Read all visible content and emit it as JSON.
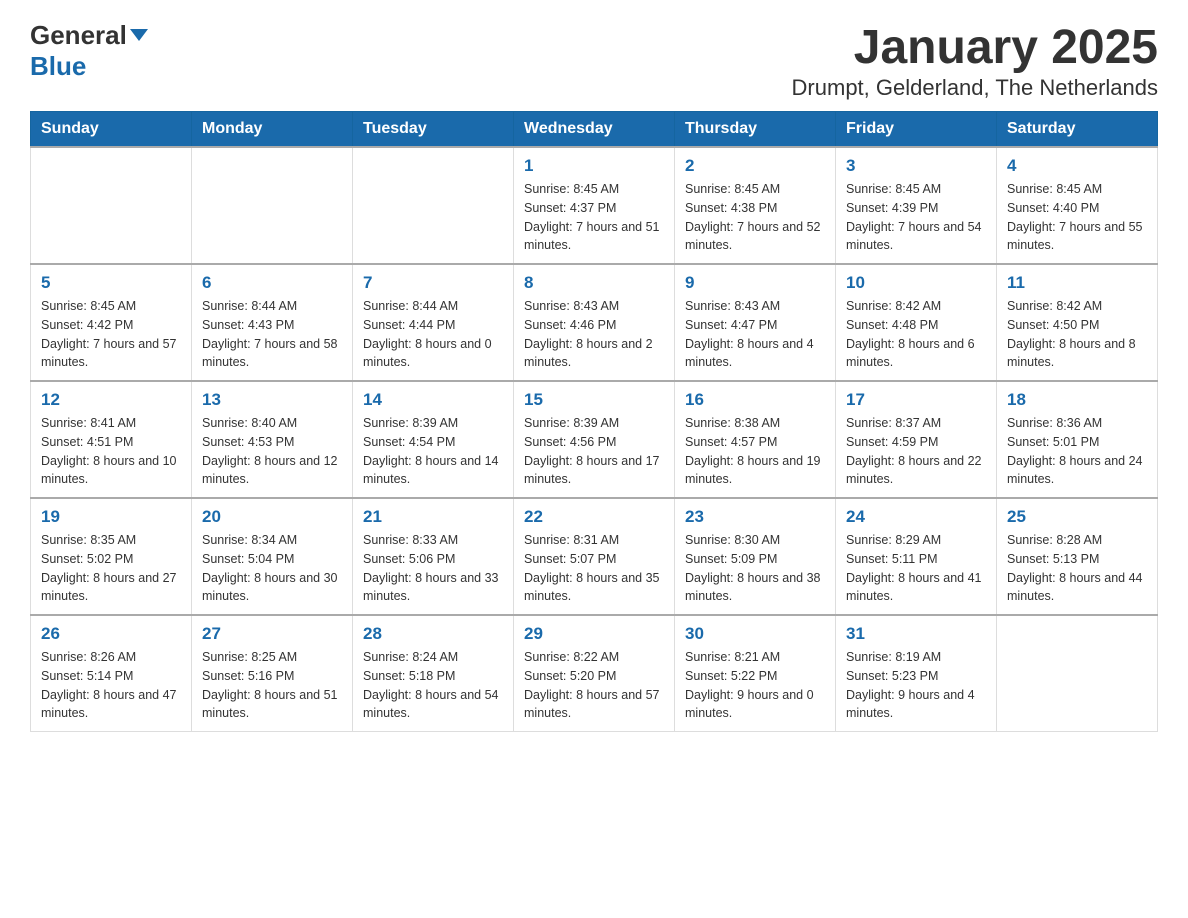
{
  "header": {
    "logo_text_general": "General",
    "logo_text_blue": "Blue",
    "title": "January 2025",
    "subtitle": "Drumpt, Gelderland, The Netherlands"
  },
  "weekdays": [
    "Sunday",
    "Monday",
    "Tuesday",
    "Wednesday",
    "Thursday",
    "Friday",
    "Saturday"
  ],
  "weeks": [
    [
      {
        "day": "",
        "info": ""
      },
      {
        "day": "",
        "info": ""
      },
      {
        "day": "",
        "info": ""
      },
      {
        "day": "1",
        "info": "Sunrise: 8:45 AM\nSunset: 4:37 PM\nDaylight: 7 hours\nand 51 minutes."
      },
      {
        "day": "2",
        "info": "Sunrise: 8:45 AM\nSunset: 4:38 PM\nDaylight: 7 hours\nand 52 minutes."
      },
      {
        "day": "3",
        "info": "Sunrise: 8:45 AM\nSunset: 4:39 PM\nDaylight: 7 hours\nand 54 minutes."
      },
      {
        "day": "4",
        "info": "Sunrise: 8:45 AM\nSunset: 4:40 PM\nDaylight: 7 hours\nand 55 minutes."
      }
    ],
    [
      {
        "day": "5",
        "info": "Sunrise: 8:45 AM\nSunset: 4:42 PM\nDaylight: 7 hours\nand 57 minutes."
      },
      {
        "day": "6",
        "info": "Sunrise: 8:44 AM\nSunset: 4:43 PM\nDaylight: 7 hours\nand 58 minutes."
      },
      {
        "day": "7",
        "info": "Sunrise: 8:44 AM\nSunset: 4:44 PM\nDaylight: 8 hours\nand 0 minutes."
      },
      {
        "day": "8",
        "info": "Sunrise: 8:43 AM\nSunset: 4:46 PM\nDaylight: 8 hours\nand 2 minutes."
      },
      {
        "day": "9",
        "info": "Sunrise: 8:43 AM\nSunset: 4:47 PM\nDaylight: 8 hours\nand 4 minutes."
      },
      {
        "day": "10",
        "info": "Sunrise: 8:42 AM\nSunset: 4:48 PM\nDaylight: 8 hours\nand 6 minutes."
      },
      {
        "day": "11",
        "info": "Sunrise: 8:42 AM\nSunset: 4:50 PM\nDaylight: 8 hours\nand 8 minutes."
      }
    ],
    [
      {
        "day": "12",
        "info": "Sunrise: 8:41 AM\nSunset: 4:51 PM\nDaylight: 8 hours\nand 10 minutes."
      },
      {
        "day": "13",
        "info": "Sunrise: 8:40 AM\nSunset: 4:53 PM\nDaylight: 8 hours\nand 12 minutes."
      },
      {
        "day": "14",
        "info": "Sunrise: 8:39 AM\nSunset: 4:54 PM\nDaylight: 8 hours\nand 14 minutes."
      },
      {
        "day": "15",
        "info": "Sunrise: 8:39 AM\nSunset: 4:56 PM\nDaylight: 8 hours\nand 17 minutes."
      },
      {
        "day": "16",
        "info": "Sunrise: 8:38 AM\nSunset: 4:57 PM\nDaylight: 8 hours\nand 19 minutes."
      },
      {
        "day": "17",
        "info": "Sunrise: 8:37 AM\nSunset: 4:59 PM\nDaylight: 8 hours\nand 22 minutes."
      },
      {
        "day": "18",
        "info": "Sunrise: 8:36 AM\nSunset: 5:01 PM\nDaylight: 8 hours\nand 24 minutes."
      }
    ],
    [
      {
        "day": "19",
        "info": "Sunrise: 8:35 AM\nSunset: 5:02 PM\nDaylight: 8 hours\nand 27 minutes."
      },
      {
        "day": "20",
        "info": "Sunrise: 8:34 AM\nSunset: 5:04 PM\nDaylight: 8 hours\nand 30 minutes."
      },
      {
        "day": "21",
        "info": "Sunrise: 8:33 AM\nSunset: 5:06 PM\nDaylight: 8 hours\nand 33 minutes."
      },
      {
        "day": "22",
        "info": "Sunrise: 8:31 AM\nSunset: 5:07 PM\nDaylight: 8 hours\nand 35 minutes."
      },
      {
        "day": "23",
        "info": "Sunrise: 8:30 AM\nSunset: 5:09 PM\nDaylight: 8 hours\nand 38 minutes."
      },
      {
        "day": "24",
        "info": "Sunrise: 8:29 AM\nSunset: 5:11 PM\nDaylight: 8 hours\nand 41 minutes."
      },
      {
        "day": "25",
        "info": "Sunrise: 8:28 AM\nSunset: 5:13 PM\nDaylight: 8 hours\nand 44 minutes."
      }
    ],
    [
      {
        "day": "26",
        "info": "Sunrise: 8:26 AM\nSunset: 5:14 PM\nDaylight: 8 hours\nand 47 minutes."
      },
      {
        "day": "27",
        "info": "Sunrise: 8:25 AM\nSunset: 5:16 PM\nDaylight: 8 hours\nand 51 minutes."
      },
      {
        "day": "28",
        "info": "Sunrise: 8:24 AM\nSunset: 5:18 PM\nDaylight: 8 hours\nand 54 minutes."
      },
      {
        "day": "29",
        "info": "Sunrise: 8:22 AM\nSunset: 5:20 PM\nDaylight: 8 hours\nand 57 minutes."
      },
      {
        "day": "30",
        "info": "Sunrise: 8:21 AM\nSunset: 5:22 PM\nDaylight: 9 hours\nand 0 minutes."
      },
      {
        "day": "31",
        "info": "Sunrise: 8:19 AM\nSunset: 5:23 PM\nDaylight: 9 hours\nand 4 minutes."
      },
      {
        "day": "",
        "info": ""
      }
    ]
  ]
}
